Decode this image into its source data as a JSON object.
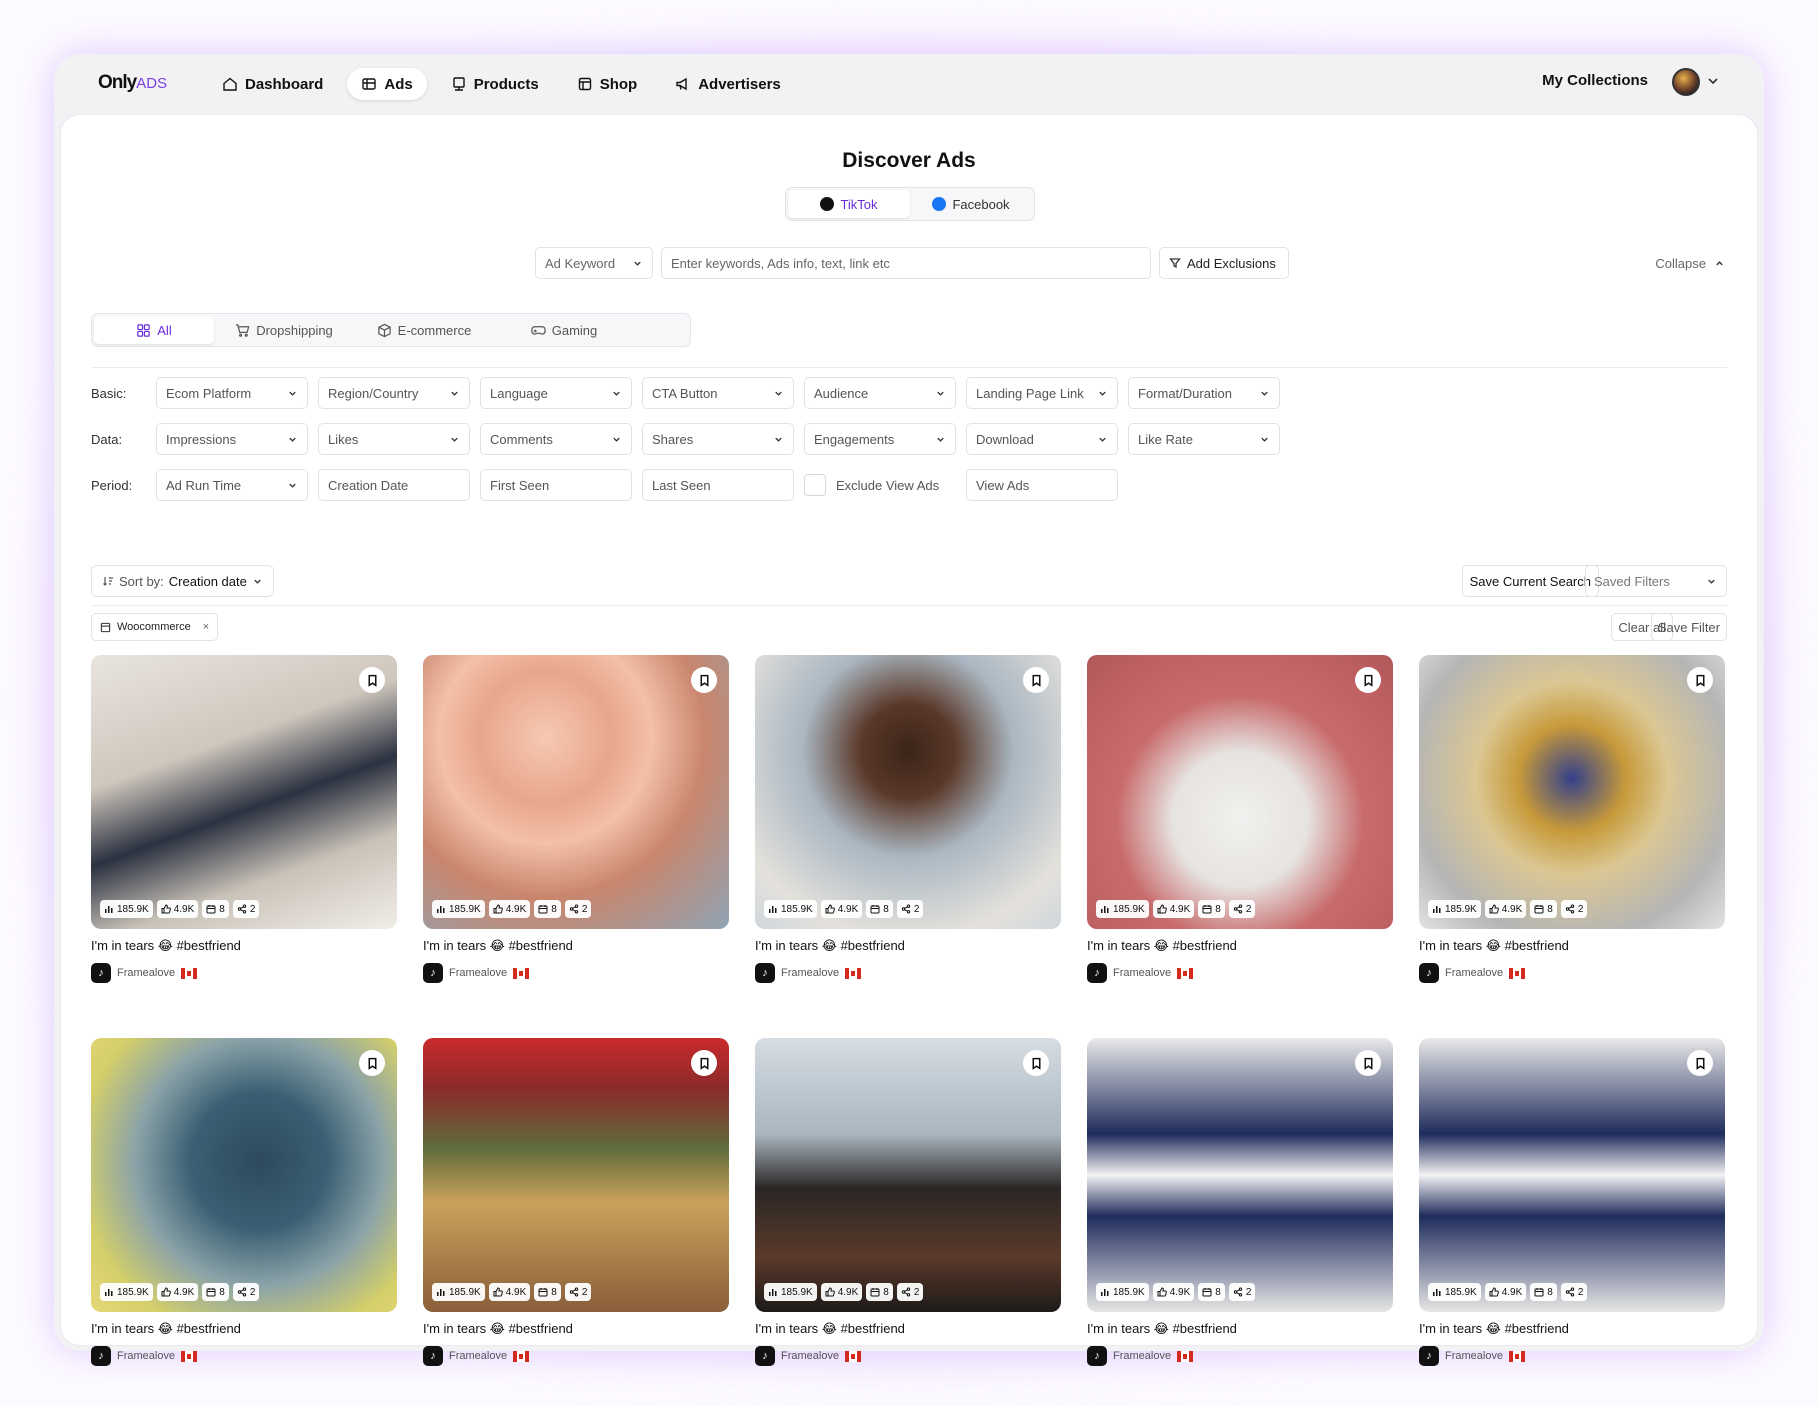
{
  "nav": {
    "logo_main": "Only",
    "logo_sub": "ADS",
    "items": [
      {
        "label": "Dashboard",
        "icon": "home-icon",
        "active": false
      },
      {
        "label": "Ads",
        "icon": "ads-icon",
        "active": true
      },
      {
        "label": "Products",
        "icon": "products-icon",
        "active": false
      },
      {
        "label": "Shop",
        "icon": "shop-icon",
        "active": false
      },
      {
        "label": "Advertisers",
        "icon": "megaphone-icon",
        "active": false
      }
    ],
    "my_collections": "My Collections"
  },
  "page": {
    "title": "Discover Ads",
    "platforms": [
      {
        "label": "TikTok",
        "active": true
      },
      {
        "label": "Facebook",
        "active": false
      }
    ]
  },
  "search": {
    "type": "Ad Keyword",
    "placeholder": "Enter keywords, Ads info, text, link etc",
    "exclusions": "Add Exclusions",
    "collapse": "Collapse"
  },
  "categories": [
    {
      "label": "All",
      "active": true
    },
    {
      "label": "Dropshipping",
      "active": false
    },
    {
      "label": "E-commerce",
      "active": false
    },
    {
      "label": "Gaming",
      "active": false
    }
  ],
  "filters": {
    "basic_label": "Basic:",
    "basic": [
      "Ecom Platform",
      "Region/Country",
      "Language",
      "CTA Button",
      "Audience",
      "Landing Page Link",
      "Format/Duration"
    ],
    "data_label": "Data:",
    "data": [
      "Impressions",
      "Likes",
      "Comments",
      "Shares",
      "Engagements",
      "Download",
      "Like Rate"
    ],
    "period_label": "Period:",
    "period": [
      "Ad Run Time",
      "Creation Date",
      "First Seen",
      "Last Seen"
    ],
    "exclude_view": "Exclude View Ads",
    "view_ads": "View Ads"
  },
  "sort": {
    "label": "Sort by:",
    "value": "Creation date"
  },
  "actions": {
    "save_search": "Save Current Search",
    "saved_filters": "Saved Filters",
    "clear_all": "Clear all",
    "save_filter": "Save Filter"
  },
  "active_tag": "Woocommerce",
  "cards": [
    {
      "caption": "I'm in tears 😂 #bestfriend",
      "author": "Framealove",
      "views": "185.9K",
      "likes": "4.9K",
      "days": "8",
      "shares": "2",
      "bg": "linear-gradient(160deg,#e9e4df 0%,#cfc7bd 35%,#2b3140 55%,#c9c2b8 75%,#f1ede8 100%)"
    },
    {
      "caption": "I'm in tears 😂 #bestfriend",
      "author": "Framealove",
      "views": "185.9K",
      "likes": "4.9K",
      "days": "8",
      "shares": "2",
      "bg": "radial-gradient(circle at 40% 30%,#f6c9b3 0%,#e8a68b 25%,#f3c0a8 40%,#c9866d 60%,#8fa4b4 100%)"
    },
    {
      "caption": "I'm in tears 😂 #bestfriend",
      "author": "Framealove",
      "views": "185.9K",
      "likes": "4.9K",
      "days": "8",
      "shares": "2",
      "bg": "radial-gradient(circle at 50% 35%,#3b2419 0%,#5a3828 20%,#aab7c2 45%,#e4e1dc 80%,#cfd6db 100%)"
    },
    {
      "caption": "I'm in tears 😂 #bestfriend",
      "author": "Framealove",
      "views": "185.9K",
      "likes": "4.9K",
      "days": "8",
      "shares": "2",
      "bg": "radial-gradient(circle at 50% 60%,#f2f1ef 0%,#e6e3e0 30%,#c86b6c 55%,#b3585a 100%)"
    },
    {
      "caption": "I'm in tears 😂 #bestfriend",
      "author": "Framealove",
      "views": "185.9K",
      "likes": "4.9K",
      "days": "8",
      "shares": "2",
      "bg": "radial-gradient(circle at 50% 45%,#34408a 0%,#c79a3a 25%,#dbc793 45%,#b5b5b5 75%,#e3e3e3 100%)"
    },
    {
      "caption": "I'm in tears 😂 #bestfriend",
      "author": "Framealove",
      "views": "185.9K",
      "likes": "4.9K",
      "days": "8",
      "shares": "2",
      "bg": "radial-gradient(circle at 55% 45%,#2e4a5c 0%,#3a5f73 30%,#8ba3a8 55%,#d4cf6a 80%,#e6d77a 100%)"
    },
    {
      "caption": "I'm in tears 😂 #bestfriend",
      "author": "Framealove",
      "views": "185.9K",
      "likes": "4.9K",
      "days": "8",
      "shares": "2",
      "bg": "linear-gradient(180deg,#c92a2a 0%,#8c2a2a 18%,#5f6b3c 40%,#c9a25a 60%,#8a5e3a 100%)"
    },
    {
      "caption": "I'm in tears 😂 #bestfriend",
      "author": "Framealove",
      "views": "185.9K",
      "likes": "4.9K",
      "days": "8",
      "shares": "2",
      "bg": "linear-gradient(180deg,#d6dde3 0%,#a9b6c0 35%,#2a2625 55%,#5b3a2a 80%,#1d1a19 100%)"
    },
    {
      "caption": "I'm in tears 😂 #bestfriend",
      "author": "Framealove",
      "views": "185.9K",
      "likes": "4.9K",
      "days": "8",
      "shares": "2",
      "bg": "linear-gradient(180deg,#e9e9e9 0%,#1f2c5c 35%,#f4f4f4 50%,#1f2c5c 65%,#e6e6e6 100%)"
    },
    {
      "caption": "I'm in tears 😂 #bestfriend",
      "author": "Framealove",
      "views": "185.9K",
      "likes": "4.9K",
      "days": "8",
      "shares": "2",
      "bg": "linear-gradient(180deg,#e9e9e9 0%,#1f2c5c 35%,#f4f4f4 50%,#1f2c5c 65%,#e6e6e6 100%)"
    }
  ],
  "colors": {
    "accent": "#6a2bd9",
    "text": "#111111",
    "flag_red": "#d52b1e"
  }
}
